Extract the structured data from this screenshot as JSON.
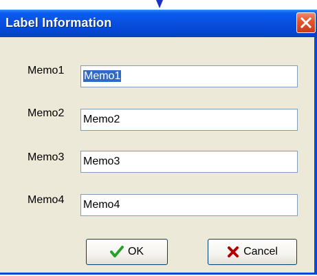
{
  "window": {
    "title": "Label Information"
  },
  "fields": [
    {
      "label": "Memo1",
      "value": "Memo1",
      "selected": true
    },
    {
      "label": "Memo2",
      "value": "Memo2",
      "selected": false
    },
    {
      "label": "Memo3",
      "value": "Memo3",
      "selected": false
    },
    {
      "label": "Memo4",
      "value": "Memo4",
      "selected": false
    }
  ],
  "buttons": {
    "ok_label": "OK",
    "cancel_label": "Cancel"
  },
  "icons": {
    "close": "close-icon",
    "ok": "checkmark-icon",
    "cancel": "cross-icon",
    "pointer": "arrow-down-icon"
  },
  "colors": {
    "titlebar": "#0a4fe0",
    "close_button": "#e5562f",
    "selection": "#316ac5",
    "ok_check": "#2aa02a",
    "cancel_cross": "#b00000",
    "window_bg": "#ece9d8"
  }
}
